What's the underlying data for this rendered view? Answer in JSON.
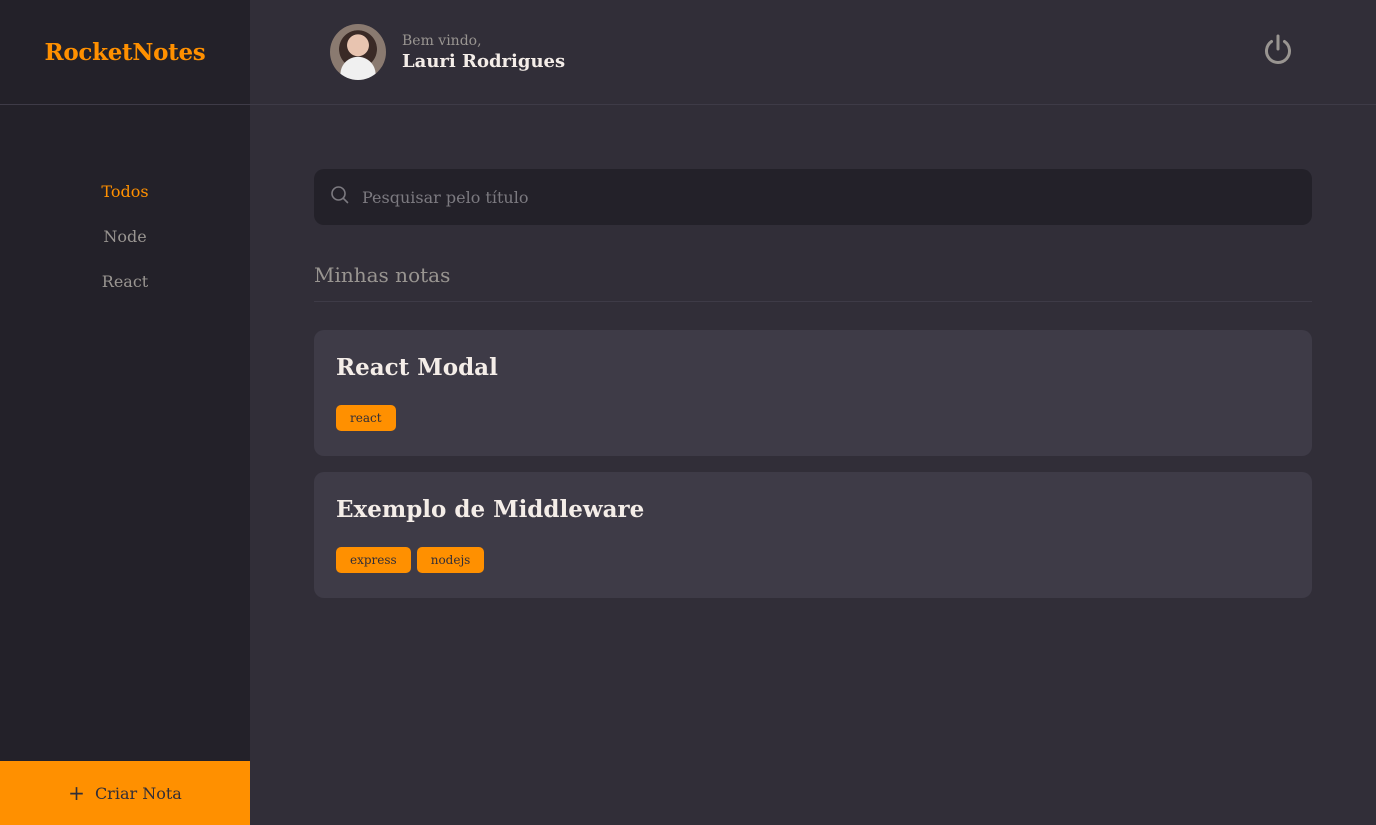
{
  "brand": "RocketNotes",
  "sidebar": {
    "items": [
      {
        "label": "Todos",
        "active": true
      },
      {
        "label": "Node",
        "active": false
      },
      {
        "label": "React",
        "active": false
      }
    ],
    "create_button": {
      "icon": "plus-icon",
      "label": "Criar Nota"
    }
  },
  "header": {
    "greeting": "Bem vindo,",
    "user_name": "Lauri Rodrigues",
    "logout_icon": "power-icon"
  },
  "search": {
    "icon": "search-icon",
    "placeholder": "Pesquisar pelo título",
    "value": ""
  },
  "section_title": "Minhas notas",
  "notes": [
    {
      "title": "React Modal",
      "tags": [
        "react"
      ]
    },
    {
      "title": "Exemplo de Middleware",
      "tags": [
        "express",
        "nodejs"
      ]
    }
  ],
  "colors": {
    "accent": "#ff9000",
    "background": "#312e38",
    "sidebar": "#232129",
    "card": "#3e3b47",
    "text": "#f4ede8",
    "muted": "#999591"
  }
}
